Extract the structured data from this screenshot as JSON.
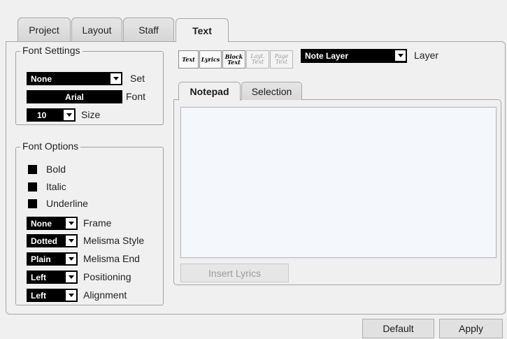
{
  "tabs": [
    "Project",
    "Layout",
    "Staff",
    "Text"
  ],
  "font_settings": {
    "legend": "Font Settings",
    "set_value": "None",
    "set_label": "Set",
    "font_value": "Arial",
    "font_label": "Font",
    "size_value": "10",
    "size_label": "Size"
  },
  "font_options": {
    "legend": "Font Options",
    "bold": "Bold",
    "italic": "Italic",
    "underline": "Underline",
    "frame_value": "None",
    "frame_label": "Frame",
    "melisma_style_value": "Dotted",
    "melisma_style_label": "Melisma Style",
    "melisma_end_value": "Plain",
    "melisma_end_label": "Melisma End",
    "positioning_value": "Left",
    "positioning_label": "Positioning",
    "alignment_value": "Left",
    "alignment_label": "Alignment"
  },
  "text_types": [
    {
      "l1": "Text",
      "l2": ""
    },
    {
      "l1": "Lyrics",
      "l2": ""
    },
    {
      "l1": "Block",
      "l2": "Text"
    },
    {
      "l1": "Layt.",
      "l2": "Text"
    },
    {
      "l1": "Page",
      "l2": "Text"
    }
  ],
  "layer": {
    "value": "Note Layer",
    "label": "Layer"
  },
  "inner_tabs": [
    "Notepad",
    "Selection"
  ],
  "insert_lyrics": "Insert Lyrics",
  "buttons": {
    "default": "Default",
    "apply": "Apply"
  }
}
